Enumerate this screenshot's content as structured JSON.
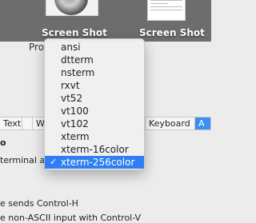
{
  "desktop": {
    "items": [
      {
        "label": "Screen Shot",
        "thumbnail": "photo-thumbnail"
      },
      {
        "label": "Screen Shot",
        "thumbnail": "document-thumbnail"
      }
    ]
  },
  "window": {
    "profile_label_fragment": "Pro",
    "tabs": [
      {
        "label": "Text",
        "active": false
      },
      {
        "label": "Wi",
        "active": false
      },
      {
        "label": "Keyboard",
        "active": false
      },
      {
        "label": "A",
        "active": true
      }
    ],
    "content": {
      "line1": "o",
      "line2": "terminal as",
      "line3": "e sends Control-H",
      "line4": "e non-ASCII input with Control-V"
    }
  },
  "popup_menu": {
    "items": [
      "ansi",
      "dtterm",
      "nsterm",
      "rxvt",
      "vt52",
      "vt100",
      "vt102",
      "xterm",
      "xterm-16color",
      "xterm-256color"
    ],
    "selected": "xterm-256color",
    "checkmark": "✓"
  },
  "colors": {
    "selection": "#2f7ff2",
    "tab_active": "#3c8ff4",
    "desktop_bg": "#6d6d6d"
  }
}
